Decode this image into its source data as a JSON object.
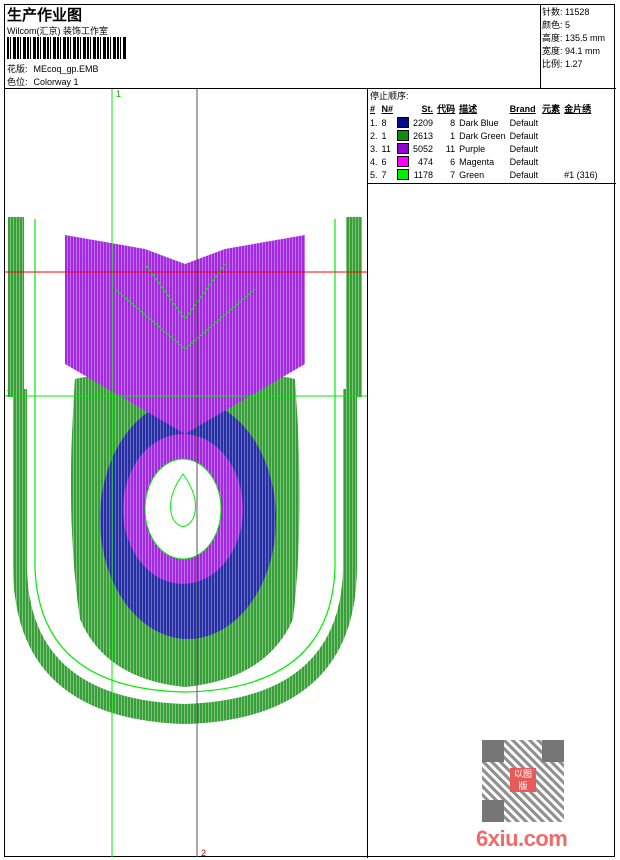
{
  "header": {
    "title": "生产作业图",
    "company": "Wilcom(汇京) 装饰工作室",
    "design_label": "花版:",
    "design_value": "MEcoq_gp.EMB",
    "colorway_label": "色位:",
    "colorway_value": "Colorway 1"
  },
  "stats": [
    {
      "label": "针数:",
      "value": "11528"
    },
    {
      "label": "颜色:",
      "value": "5"
    },
    {
      "label": "高度:",
      "value": "135.5 mm"
    },
    {
      "label": "宽度:",
      "value": "94.1 mm"
    },
    {
      "label": "比例:",
      "value": "1.27"
    }
  ],
  "stop_sequence": {
    "title": "停止顺序:",
    "columns": [
      "#",
      "N#",
      "St.",
      "代码",
      "描述",
      "Brand",
      "元素",
      "金片绣"
    ],
    "rows": [
      {
        "idx": "1.",
        "n": "8",
        "color": "#000c8c",
        "st": "2209",
        "code": "8",
        "desc": "Dark Blue",
        "brand": "Default",
        "elem": "",
        "seq": ""
      },
      {
        "idx": "2.",
        "n": "1",
        "color": "#0e8c0e",
        "st": "2613",
        "code": "1",
        "desc": "Dark Green",
        "brand": "Default",
        "elem": "",
        "seq": ""
      },
      {
        "idx": "3.",
        "n": "11",
        "color": "#9400d3",
        "st": "5052",
        "code": "11",
        "desc": "Purple",
        "brand": "Default",
        "elem": "",
        "seq": ""
      },
      {
        "idx": "4.",
        "n": "6",
        "color": "#ff00ff",
        "st": "474",
        "code": "6",
        "desc": "Magenta",
        "brand": "Default",
        "elem": "",
        "seq": ""
      },
      {
        "idx": "5.",
        "n": "7",
        "color": "#00ee00",
        "st": "1178",
        "code": "7",
        "desc": "Green",
        "brand": "Default",
        "elem": "",
        "seq": "#1 (316)"
      }
    ]
  },
  "canvas": {
    "axis_top_label": "1",
    "axis_bottom_label": "2",
    "axis_left_label": "1"
  },
  "watermark": {
    "text": "6xiu.com",
    "stamp": "以图版"
  }
}
